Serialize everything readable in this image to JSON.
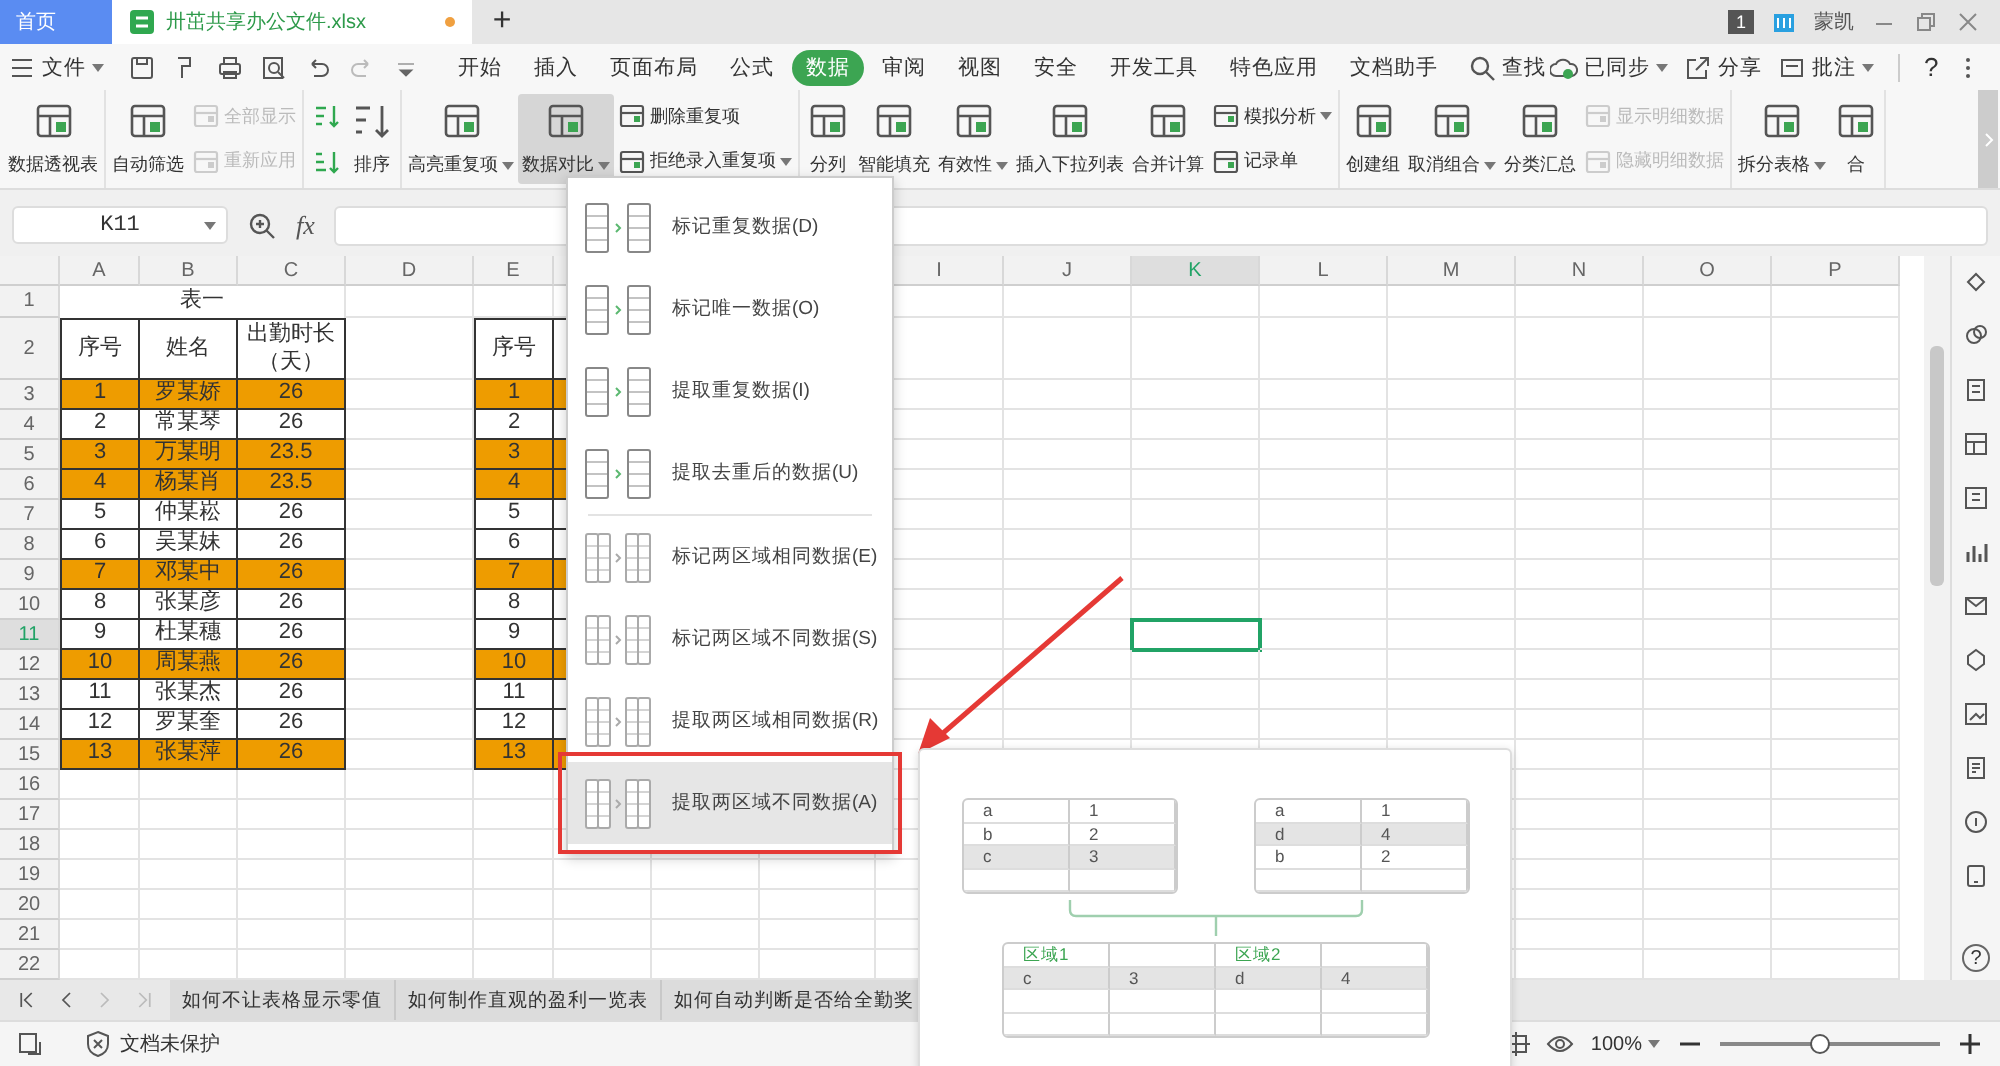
{
  "title_bar": {
    "tabs": [
      {
        "label": "首页",
        "kind": "home",
        "selected": false,
        "unsaved": false
      },
      {
        "label": "卅茁共享办公文件.xlsx",
        "kind": "file",
        "selected": true,
        "unsaved": true
      }
    ],
    "new_tab": "+",
    "badge": "1",
    "user": "蒙凯"
  },
  "menu_bar": {
    "file_label": "文件",
    "tabs": [
      {
        "label": "开始",
        "selected": false
      },
      {
        "label": "插入",
        "selected": false
      },
      {
        "label": "页面布局",
        "selected": false
      },
      {
        "label": "公式",
        "selected": false
      },
      {
        "label": "数据",
        "selected": true
      },
      {
        "label": "审阅",
        "selected": false
      },
      {
        "label": "视图",
        "selected": false
      },
      {
        "label": "安全",
        "selected": false
      },
      {
        "label": "开发工具",
        "selected": false
      },
      {
        "label": "特色应用",
        "selected": false
      },
      {
        "label": "文档助手",
        "selected": false
      }
    ],
    "search": "查找",
    "sync": "已同步",
    "share": "分享",
    "comment": "批注",
    "help": "?"
  },
  "ribbon": {
    "groups": [
      {
        "items": [
          {
            "kind": "big",
            "label": "数据透视表",
            "dropdown": false,
            "selected": false
          }
        ]
      },
      {
        "items": [
          {
            "kind": "big",
            "label": "自动筛选",
            "dropdown": false,
            "selected": false
          },
          {
            "kind": "stack",
            "items": [
              {
                "label": "全部显示",
                "dropdown": false,
                "disabled": true
              },
              {
                "label": "重新应用",
                "dropdown": false,
                "disabled": true
              }
            ]
          }
        ]
      },
      {
        "items": [
          {
            "kind": "sort",
            "label": "排序"
          }
        ]
      },
      {
        "items": [
          {
            "kind": "big",
            "label": "高亮重复项",
            "dropdown": true,
            "selected": false
          },
          {
            "kind": "big",
            "label": "数据对比",
            "dropdown": true,
            "selected": true
          },
          {
            "kind": "stack",
            "items": [
              {
                "label": "删除重复项",
                "dropdown": false,
                "disabled": false
              },
              {
                "label": "拒绝录入重复项",
                "dropdown": true,
                "disabled": false
              }
            ]
          }
        ]
      },
      {
        "items": [
          {
            "kind": "big",
            "label": "分列",
            "dropdown": false,
            "selected": false
          },
          {
            "kind": "big",
            "label": "智能填充",
            "dropdown": false,
            "selected": false
          },
          {
            "kind": "big",
            "label": "有效性",
            "dropdown": true,
            "selected": false
          },
          {
            "kind": "big",
            "label": "插入下拉列表",
            "dropdown": false,
            "selected": false
          },
          {
            "kind": "big",
            "label": "合并计算",
            "dropdown": false,
            "selected": false
          },
          {
            "kind": "stack",
            "items": [
              {
                "label": "模拟分析",
                "dropdown": true,
                "disabled": false
              },
              {
                "label": "记录单",
                "dropdown": false,
                "disabled": false
              }
            ]
          }
        ]
      },
      {
        "items": [
          {
            "kind": "big",
            "label": "创建组",
            "dropdown": false,
            "selected": false
          },
          {
            "kind": "big",
            "label": "取消组合",
            "dropdown": true,
            "selected": false
          },
          {
            "kind": "big",
            "label": "分类汇总",
            "dropdown": false,
            "selected": false
          },
          {
            "kind": "stack",
            "items": [
              {
                "label": "显示明细数据",
                "dropdown": false,
                "disabled": true
              },
              {
                "label": "隐藏明细数据",
                "dropdown": false,
                "disabled": true
              }
            ]
          }
        ]
      },
      {
        "items": [
          {
            "kind": "big",
            "label": "拆分表格",
            "dropdown": true,
            "selected": false
          },
          {
            "kind": "big",
            "label": "合",
            "dropdown": false,
            "selected": false
          }
        ]
      }
    ]
  },
  "formula_bar": {
    "name_box": "K11",
    "fx": "fx"
  },
  "sheet": {
    "columns": [
      {
        "label": "A",
        "selected": false
      },
      {
        "label": "B",
        "selected": false
      },
      {
        "label": "C",
        "selected": false
      },
      {
        "label": "D",
        "selected": false
      },
      {
        "label": "E",
        "selected": false
      },
      {
        "label": "I",
        "selected": false
      },
      {
        "label": "J",
        "selected": false
      },
      {
        "label": "K",
        "selected": true
      },
      {
        "label": "L",
        "selected": false
      },
      {
        "label": "M",
        "selected": false
      },
      {
        "label": "N",
        "selected": false
      },
      {
        "label": "O",
        "selected": false
      },
      {
        "label": "P",
        "selected": false
      }
    ],
    "rows": [
      {
        "label": "1",
        "selected": false
      },
      {
        "label": "2",
        "selected": false
      },
      {
        "label": "3",
        "selected": false
      },
      {
        "label": "4",
        "selected": false
      },
      {
        "label": "5",
        "selected": false
      },
      {
        "label": "6",
        "selected": false
      },
      {
        "label": "7",
        "selected": false
      },
      {
        "label": "8",
        "selected": false
      },
      {
        "label": "9",
        "selected": false
      },
      {
        "label": "10",
        "selected": false
      },
      {
        "label": "11",
        "selected": true
      },
      {
        "label": "12",
        "selected": false
      },
      {
        "label": "13",
        "selected": false
      },
      {
        "label": "14",
        "selected": false
      },
      {
        "label": "15",
        "selected": false
      },
      {
        "label": "16",
        "selected": false
      },
      {
        "label": "17",
        "selected": false
      },
      {
        "label": "18",
        "selected": false
      },
      {
        "label": "19",
        "selected": false
      },
      {
        "label": "20",
        "selected": false
      },
      {
        "label": "21",
        "selected": false
      },
      {
        "label": "22",
        "selected": false
      }
    ],
    "table_1": {
      "title": "表一",
      "headers": [
        "序号",
        "姓名",
        "出勤时长（天）"
      ],
      "rows": [
        {
          "no": "1",
          "name": "罗某娇",
          "days": "26",
          "highlighted": true
        },
        {
          "no": "2",
          "name": "常某琴",
          "days": "26",
          "highlighted": false
        },
        {
          "no": "3",
          "name": "万某明",
          "days": "23.5",
          "highlighted": true
        },
        {
          "no": "4",
          "name": "杨某肖",
          "days": "23.5",
          "highlighted": true
        },
        {
          "no": "5",
          "name": "仲某崧",
          "days": "26",
          "highlighted": false
        },
        {
          "no": "6",
          "name": "吴某妹",
          "days": "26",
          "highlighted": false
        },
        {
          "no": "7",
          "name": "邓某中",
          "days": "26",
          "highlighted": true
        },
        {
          "no": "8",
          "name": "张某彦",
          "days": "26",
          "highlighted": false
        },
        {
          "no": "9",
          "name": "杜某穗",
          "days": "26",
          "highlighted": false
        },
        {
          "no": "10",
          "name": "周某燕",
          "days": "26",
          "highlighted": true
        },
        {
          "no": "11",
          "name": "张某杰",
          "days": "26",
          "highlighted": false
        },
        {
          "no": "12",
          "name": "罗某奎",
          "days": "26",
          "highlighted": false
        },
        {
          "no": "13",
          "name": "张某萍",
          "days": "26",
          "highlighted": true
        }
      ]
    },
    "table_2": {
      "header": "序号",
      "rows": [
        {
          "no": "1",
          "highlighted": true
        },
        {
          "no": "2",
          "highlighted": false
        },
        {
          "no": "3",
          "highlighted": true
        },
        {
          "no": "4",
          "highlighted": true
        },
        {
          "no": "5",
          "highlighted": false
        },
        {
          "no": "6",
          "highlighted": false
        },
        {
          "no": "7",
          "highlighted": true
        },
        {
          "no": "8",
          "highlighted": false
        },
        {
          "no": "9",
          "highlighted": false
        },
        {
          "no": "10",
          "highlighted": true
        },
        {
          "no": "11",
          "highlighted": false
        },
        {
          "no": "12",
          "highlighted": false
        },
        {
          "no": "13",
          "highlighted": true
        }
      ]
    }
  },
  "menu": {
    "items": [
      {
        "label": "标记重复数据(D)",
        "kind": "single",
        "selected": false
      },
      {
        "label": "标记唯一数据(O)",
        "kind": "single",
        "selected": false
      },
      {
        "label": "提取重复数据(I)",
        "kind": "single",
        "selected": false
      },
      {
        "label": "提取去重后的数据(U)",
        "kind": "single",
        "selected": false
      },
      {
        "label": "标记两区域相同数据(E)",
        "kind": "two",
        "selected": false
      },
      {
        "label": "标记两区域不同数据(S)",
        "kind": "two",
        "selected": false
      },
      {
        "label": "提取两区域相同数据(R)",
        "kind": "two",
        "selected": false
      },
      {
        "label": "提取两区域不同数据(A)",
        "kind": "two",
        "selected": true
      }
    ]
  },
  "preview": {
    "area_1": [
      {
        "cells": [
          "a",
          "1"
        ],
        "highlighted": false
      },
      {
        "cells": [
          "b",
          "2"
        ],
        "highlighted": false
      },
      {
        "cells": [
          "c",
          "3"
        ],
        "highlighted": true
      }
    ],
    "area_2": [
      {
        "cells": [
          "a",
          "1"
        ],
        "highlighted": false
      },
      {
        "cells": [
          "d",
          "4"
        ],
        "highlighted": true
      },
      {
        "cells": [
          "b",
          "2"
        ],
        "highlighted": false
      }
    ],
    "result": {
      "headers": [
        "区域1",
        "区域2"
      ],
      "rows": [
        {
          "cells": [
            "c",
            "3",
            "d",
            "4"
          ],
          "highlighted": true
        }
      ]
    }
  },
  "sheet_tabs": {
    "tabs": [
      {
        "label": "如何不让表格显示零值",
        "selected": false
      },
      {
        "label": "如何制作直观的盈利一览表",
        "selected": false
      },
      {
        "label": "如何自动判断是否给全勤奖",
        "selected": false
      }
    ]
  },
  "status_bar": {
    "protection": "文档未保护",
    "zoom": "100%",
    "zoom_slider": {
      "level": 0.45
    }
  },
  "sidebar": {
    "help": "?"
  }
}
